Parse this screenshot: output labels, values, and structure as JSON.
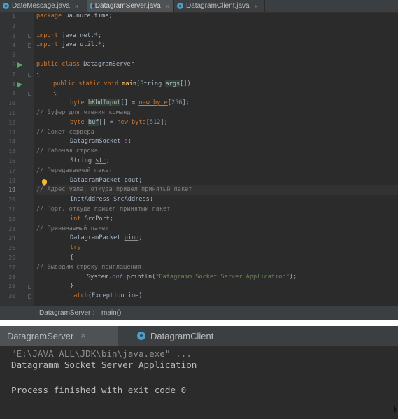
{
  "editor": {
    "tabs": [
      {
        "label": "DateMessage.java",
        "active": false
      },
      {
        "label": "DatagramServer.java",
        "active": true
      },
      {
        "label": "DatagramClient.java",
        "active": false
      }
    ],
    "close_glyph": "×",
    "line_numbers": [
      "1",
      "2",
      "3",
      "4",
      "5",
      "6",
      "7",
      "8",
      "9",
      "10",
      "11",
      "12",
      "13",
      "14",
      "15",
      "16",
      "17",
      "18",
      "19",
      "20",
      "21",
      "22",
      "23",
      "24",
      "25",
      "26",
      "27",
      "28",
      "29",
      "30"
    ],
    "code": {
      "l1_kw": "package",
      "l1_rest": " ua.nure.time;",
      "l3_kw": "import",
      "l3_rest": " java.net.*;",
      "l4_kw": "import",
      "l4_rest": " java.util.*;",
      "l6_kw": "public class",
      "l6_rest": " DatagramServer",
      "l7": "{",
      "l8_kw": "public static void",
      "l8_fn": "main",
      "l8_a": "(String ",
      "l8_p": "args",
      "l8_b": "[])",
      "l9": "{",
      "l10_kw": "byte",
      "l10_var": "bKbdInput",
      "l10_a": "[] = ",
      "l10_new": "new byte",
      "l10_b": "[",
      "l10_num": "256",
      "l10_c": "];",
      "l11": "// Буфер для чтения команд",
      "l12_kw": "byte",
      "l12_var": "buf",
      "l12_a": "[] = ",
      "l12_new": "new byte",
      "l12_b": "[",
      "l12_num": "512",
      "l12_c": "];",
      "l13": "// Сокет сервера",
      "l14": "DatagramSocket ",
      "l14_var": "s",
      "l14_end": ";",
      "l15": "// Рабочая строка",
      "l16": "String ",
      "l16_var": "str",
      "l16_end": ";",
      "l17": "// Передаваемый пакет",
      "l18": "DatagramPacket pout;",
      "l19": "// Адрес узла, откуда пришел принятый пакет",
      "l20": "InetAddress SrcAddress;",
      "l21": "// Порт, откуда пришел принятый пакет",
      "l22_kw": "int",
      "l22_rest": " SrcPort;",
      "l23": "// Принимаемый пакет",
      "l24": "DatagramPacket ",
      "l24_var": "pinp",
      "l24_end": ";",
      "l25": "try",
      "l26": "{",
      "l27": "// Выводим строку приглашения",
      "l28_a": "System.",
      "l28_out": "out",
      "l28_b": ".println(",
      "l28_str": "\"Datagramm Socket Server Application\"",
      "l28_c": ");",
      "l29": "}",
      "l30_kw": "catch",
      "l30_rest": "(Exception ioe)"
    },
    "breadcrumb": {
      "class": "DatagramServer",
      "separator": "〉",
      "method": "main()"
    }
  },
  "console": {
    "tabs": [
      {
        "label": "DatagramServer",
        "active": true
      },
      {
        "label": "DatagramClient",
        "active": false
      }
    ],
    "close_glyph": "×",
    "lines": {
      "cmd": "\"E:\\JAVA ALL\\JDK\\bin\\java.exe\" ...",
      "out": "Datagramm Socket Server Application",
      "exit": "Process finished with exit code 0"
    }
  },
  "colors": {
    "editor_bg": "#2b2b2b",
    "keyword": "#cc7832",
    "comment": "#808080",
    "string": "#6a8759",
    "number": "#6897bb"
  }
}
